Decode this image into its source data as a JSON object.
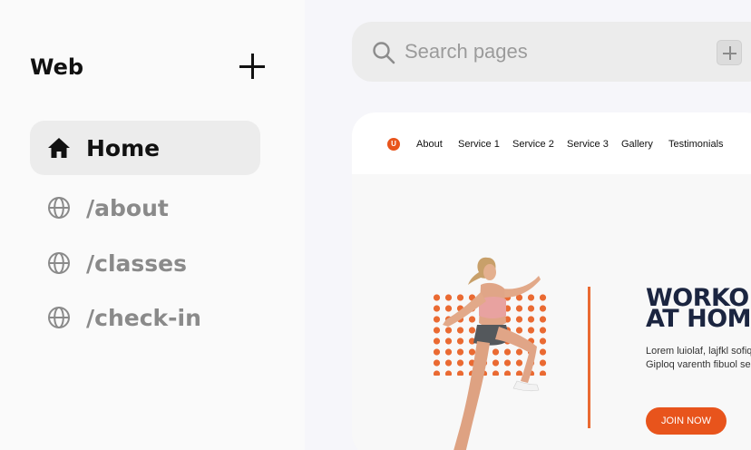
{
  "sidebar": {
    "title": "Web",
    "add_icon": "plus-icon",
    "items": [
      {
        "label": "Home",
        "icon": "home-icon",
        "active": true
      },
      {
        "label": "/about",
        "icon": "globe-icon",
        "active": false
      },
      {
        "label": "/classes",
        "icon": "globe-icon",
        "active": false
      },
      {
        "label": "/check-in",
        "icon": "globe-icon",
        "active": false
      }
    ]
  },
  "search": {
    "placeholder": "Search pages",
    "value": "",
    "icon": "search-icon",
    "add_icon": "plus-icon"
  },
  "preview": {
    "logo": "U",
    "nav": [
      "About",
      "Service 1",
      "Service 2",
      "Service 3",
      "Gallery",
      "Testimonials"
    ],
    "hero": {
      "title": "WORKO\nAT HOM",
      "text": "Lorem luiolaf, lajfkl sofiqu\nGiploq varenth fibuol seri",
      "button": "JOIN NOW"
    }
  },
  "colors": {
    "accent": "#e8541c",
    "heading": "#1b2540",
    "sidebar_active": "#ececec",
    "search_bg": "#ececec"
  }
}
